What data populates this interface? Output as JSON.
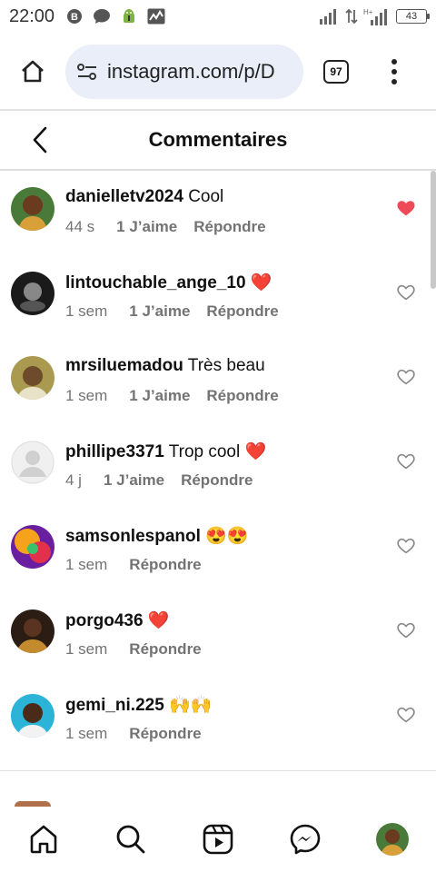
{
  "status_bar": {
    "time": "22:00",
    "battery": "43"
  },
  "browser": {
    "url": "instagram.com/p/D",
    "tab_count": "97"
  },
  "header": {
    "title": "Commentaires"
  },
  "comments": [
    {
      "user": "danielletv2024",
      "text": " Cool",
      "time": "44 s",
      "likes": "1 J’aime",
      "reply": "Répondre",
      "liked": true
    },
    {
      "user": "lintouchable_ange_10",
      "text": " ❤️",
      "time": "1 sem",
      "likes": "1 J’aime",
      "reply": "Répondre",
      "liked": false
    },
    {
      "user": "mrsiluemadou",
      "text": " Très beau",
      "time": "1 sem",
      "likes": "1 J’aime",
      "reply": "Répondre",
      "liked": false
    },
    {
      "user": "phillipe3371",
      "text": " Trop cool ❤️",
      "time": "4 j",
      "likes": "1 J’aime",
      "reply": "Répondre",
      "liked": false
    },
    {
      "user": "samsonlespanol",
      "text": " 😍😍",
      "time": "1 sem",
      "likes": "",
      "reply": "Répondre",
      "liked": false
    },
    {
      "user": "porgo436",
      "text": " ❤️",
      "time": "1 sem",
      "likes": "",
      "reply": "Répondre",
      "liked": false
    },
    {
      "user": "gemi_ni.225",
      "text": " 🙌🙌",
      "time": "1 sem",
      "likes": "",
      "reply": "Répondre",
      "liked": false
    }
  ],
  "colors": {
    "liked_heart": "#ed4956",
    "meta_text": "#737373",
    "url_bar_bg": "#e9eef8"
  },
  "icons": {
    "nav": [
      "home-icon",
      "search-icon",
      "reels-icon",
      "messenger-icon",
      "profile-avatar"
    ]
  }
}
